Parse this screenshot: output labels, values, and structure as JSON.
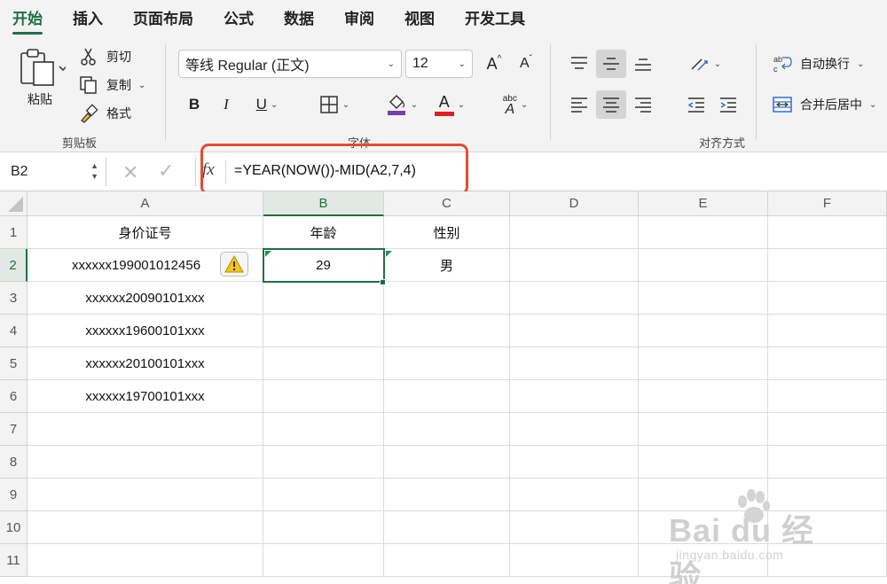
{
  "tabs": [
    "开始",
    "插入",
    "页面布局",
    "公式",
    "数据",
    "审阅",
    "视图",
    "开发工具"
  ],
  "clipboard": {
    "paste": "粘贴",
    "cut": "剪切",
    "copy": "复制",
    "format_painter": "格式",
    "group": "剪贴板"
  },
  "font": {
    "name": "等线 Regular (正文)",
    "size": "12",
    "group": "字体",
    "bold": "B",
    "italic": "I",
    "underline": "U",
    "grow": "A",
    "shrink": "A",
    "color_letter": "A",
    "phonetic_top": "abc",
    "phonetic_letter": "A",
    "fill_color": "#7b3fa0",
    "font_color": "#e02020"
  },
  "alignment": {
    "wrap": "自动换行",
    "merge": "合并后居中",
    "group": "对齐方式"
  },
  "formula_bar": {
    "cell_ref": "B2",
    "fx": "fx",
    "formula": "=YEAR(NOW())-MID(A2,7,4)"
  },
  "columns": [
    "A",
    "B",
    "C",
    "D",
    "E",
    "F"
  ],
  "rows": [
    "1",
    "2",
    "3",
    "4",
    "5",
    "6",
    "7",
    "8",
    "9",
    "10",
    "11"
  ],
  "cells": {
    "A1": "身价证号",
    "B1": "年龄",
    "C1": "性别",
    "A2": "xxxxxx199001012456",
    "B2": "29",
    "C2": "男",
    "A3": "xxxxxx20090101xxx",
    "A4": "xxxxxx19600101xxx",
    "A5": "xxxxxx20100101xxx",
    "A6": "xxxxxx19700101xxx"
  },
  "watermark": {
    "main": "Bai du 经验",
    "sub": "jingyan.baidu.com"
  },
  "colors": {
    "accent": "#1f6e43",
    "highlight": "#e44b35"
  }
}
